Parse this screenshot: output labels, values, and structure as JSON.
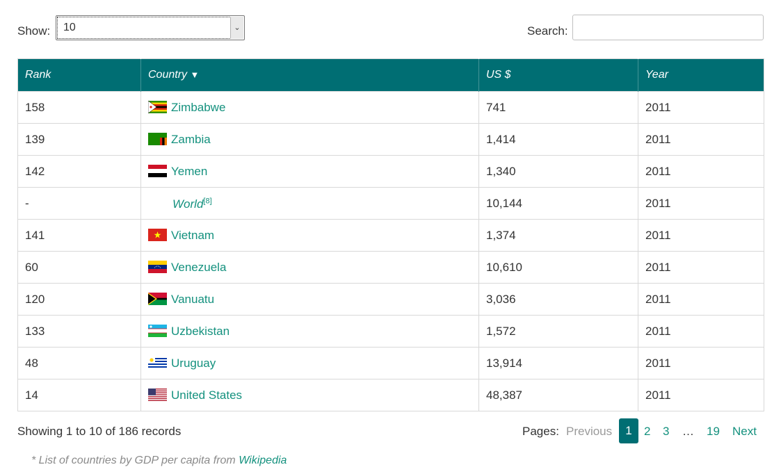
{
  "controls": {
    "show_label": "Show:",
    "show_value": "10",
    "search_label": "Search:",
    "search_value": ""
  },
  "table": {
    "headers": [
      "Rank",
      "Country",
      "US $",
      "Year"
    ],
    "sorted_column": "Country",
    "sort_direction": "descending",
    "rows": [
      {
        "rank": "158",
        "country": "Zimbabwe",
        "flag": "zimbabwe-flag-icon",
        "usd": "741",
        "year": "2011"
      },
      {
        "rank": "139",
        "country": "Zambia",
        "flag": "zambia-flag-icon",
        "usd": "1,414",
        "year": "2011"
      },
      {
        "rank": "142",
        "country": "Yemen",
        "flag": "yemen-flag-icon",
        "usd": "1,340",
        "year": "2011"
      },
      {
        "rank": "-",
        "country": "World",
        "ref": "[8]",
        "flag": "",
        "usd": "10,144",
        "year": "2011"
      },
      {
        "rank": "141",
        "country": "Vietnam",
        "flag": "vietnam-flag-icon",
        "usd": "1,374",
        "year": "2011"
      },
      {
        "rank": "60",
        "country": "Venezuela",
        "flag": "venezuela-flag-icon",
        "usd": "10,610",
        "year": "2011"
      },
      {
        "rank": "120",
        "country": "Vanuatu",
        "flag": "vanuatu-flag-icon",
        "usd": "3,036",
        "year": "2011"
      },
      {
        "rank": "133",
        "country": "Uzbekistan",
        "flag": "uzbekistan-flag-icon",
        "usd": "1,572",
        "year": "2011"
      },
      {
        "rank": "48",
        "country": "Uruguay",
        "flag": "uruguay-flag-icon",
        "usd": "13,914",
        "year": "2011"
      },
      {
        "rank": "14",
        "country": "United States",
        "flag": "united-states-flag-icon",
        "usd": "48,387",
        "year": "2011"
      }
    ]
  },
  "footer": {
    "summary": "Showing 1 to 10 of 186 records",
    "pages_label": "Pages:",
    "previous": "Previous",
    "pages": [
      "1",
      "2",
      "3"
    ],
    "current_page": "1",
    "ellipsis": "…",
    "last_page": "19",
    "next": "Next"
  },
  "source": {
    "prefix": "* List of countries by GDP per capita from ",
    "link": "Wikipedia"
  },
  "colors": {
    "header_bg": "#006e73",
    "link": "#14917e"
  }
}
